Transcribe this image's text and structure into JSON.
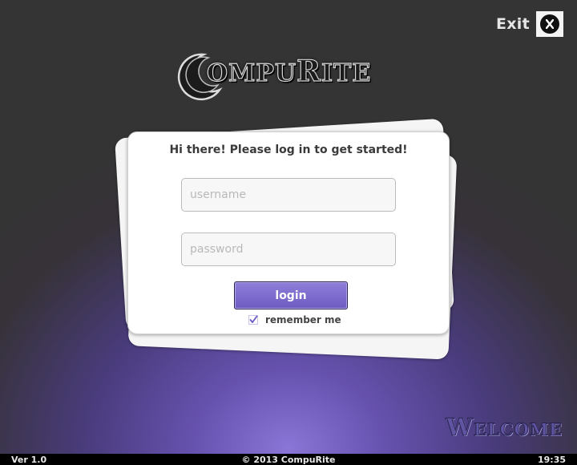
{
  "window": {
    "exit_label": "Exit",
    "exit_icon": "close-x-icon"
  },
  "logo": {
    "first_letter": "C",
    "rest_part1": "OMPU",
    "rest_part2": "R",
    "rest_part3": "ITE"
  },
  "login_card": {
    "greeting": "Hi there! Please log in to get started!",
    "username_placeholder": "username",
    "username_value": "",
    "password_placeholder": "password",
    "password_value": "",
    "login_label": "login",
    "remember_label": "remember me",
    "remember_checked": true
  },
  "watermark": "Welcome",
  "footer": {
    "version": "Ver 1.0",
    "copyright": "© 2013 CompuRite",
    "time": "19:35"
  },
  "colors": {
    "accent": "#7b68cc",
    "background_dark": "#343434",
    "glow": "#8a76d6"
  }
}
